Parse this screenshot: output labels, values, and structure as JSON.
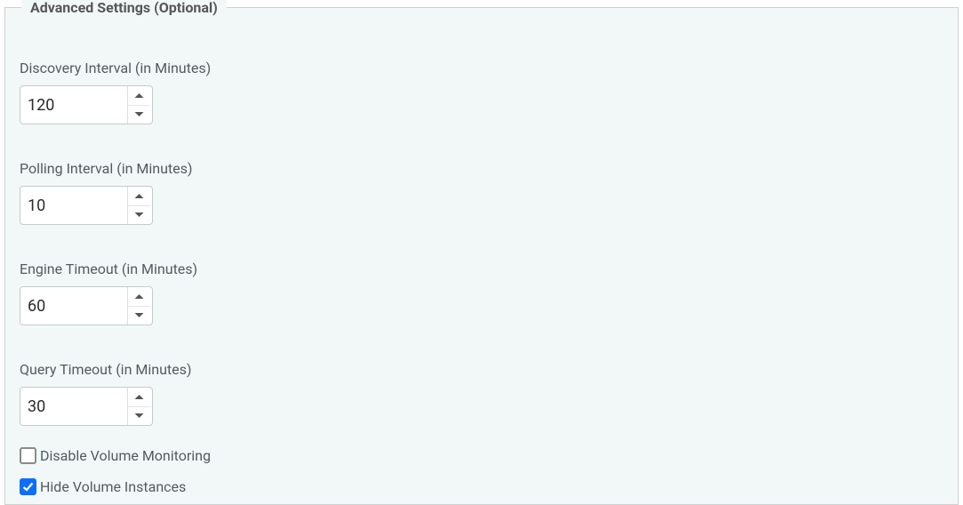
{
  "fieldset": {
    "legend": "Advanced Settings (Optional)"
  },
  "fields": {
    "discovery_interval": {
      "label": "Discovery Interval (in Minutes)",
      "value": "120"
    },
    "polling_interval": {
      "label": "Polling Interval (in Minutes)",
      "value": "10"
    },
    "engine_timeout": {
      "label": "Engine Timeout (in Minutes)",
      "value": "60"
    },
    "query_timeout": {
      "label": "Query Timeout (in Minutes)",
      "value": "30"
    }
  },
  "checkboxes": {
    "disable_volume_monitoring": {
      "label": "Disable Volume Monitoring",
      "checked": false
    },
    "hide_volume_instances": {
      "label": "Hide Volume Instances",
      "checked": true
    }
  }
}
